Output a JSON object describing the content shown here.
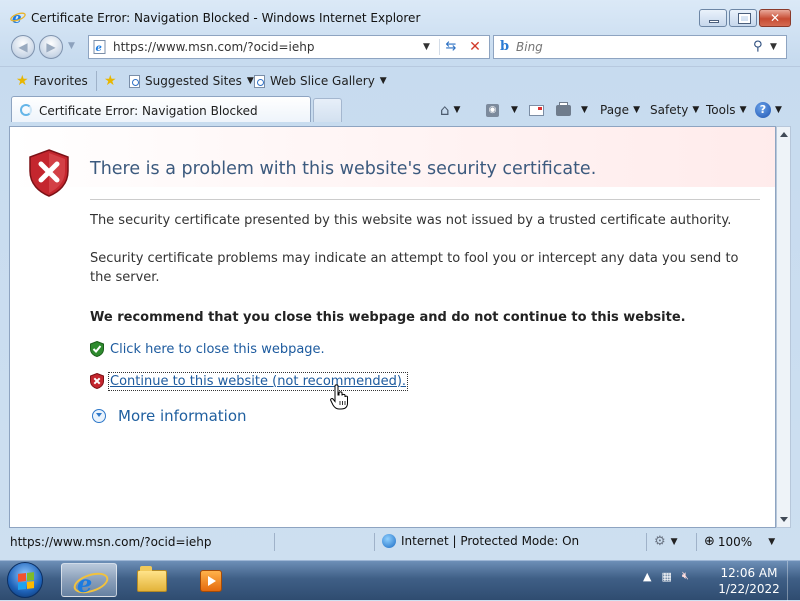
{
  "window": {
    "title": "Certificate Error: Navigation Blocked - Windows Internet Explorer"
  },
  "address_bar": {
    "url": "https://www.msn.com/?ocid=iehp"
  },
  "search": {
    "placeholder": "Bing"
  },
  "favorites_bar": {
    "favorites_label": "Favorites",
    "suggested_sites_label": "Suggested Sites",
    "web_slice_gallery_label": "Web Slice Gallery"
  },
  "tab": {
    "label": "Certificate Error: Navigation Blocked"
  },
  "command_bar": {
    "page_label": "Page",
    "safety_label": "Safety",
    "tools_label": "Tools"
  },
  "content": {
    "title": "There is a problem with this website's security certificate.",
    "paragraph_1": "The security certificate presented by this website was not issued by a trusted certificate authority.",
    "paragraph_2": "Security certificate problems may indicate an attempt to fool you or intercept any data you send to the server.",
    "recommendation": "We recommend that you close this webpage and do not continue to this website.",
    "close_link": "Click here to close this webpage.",
    "continue_link": "Continue to this website (not recommended).",
    "more_info": "More information"
  },
  "status_bar": {
    "url": "https://www.msn.com/?ocid=iehp",
    "zone": "Internet | Protected Mode: On",
    "zoom": "100%"
  },
  "taskbar": {
    "time": "12:06 AM",
    "date": "1/22/2022"
  },
  "colors": {
    "title_text": "#3c5a7e",
    "link": "#1c5a9e",
    "error_red": "#c4262e",
    "safe_green": "#2e8b2e"
  },
  "icons": [
    "ie-icon",
    "back-arrow-icon",
    "forward-arrow-icon",
    "refresh-icon",
    "stop-icon",
    "bing-icon",
    "search-icon",
    "favorites-star-icon",
    "home-icon",
    "feeds-icon",
    "mail-icon",
    "print-icon",
    "help-icon",
    "shield-error-icon",
    "shield-ok-icon",
    "shield-x-icon",
    "expand-circle-icon",
    "hand-cursor-icon",
    "globe-icon",
    "windows-orb-icon",
    "folder-icon",
    "media-player-icon"
  ]
}
